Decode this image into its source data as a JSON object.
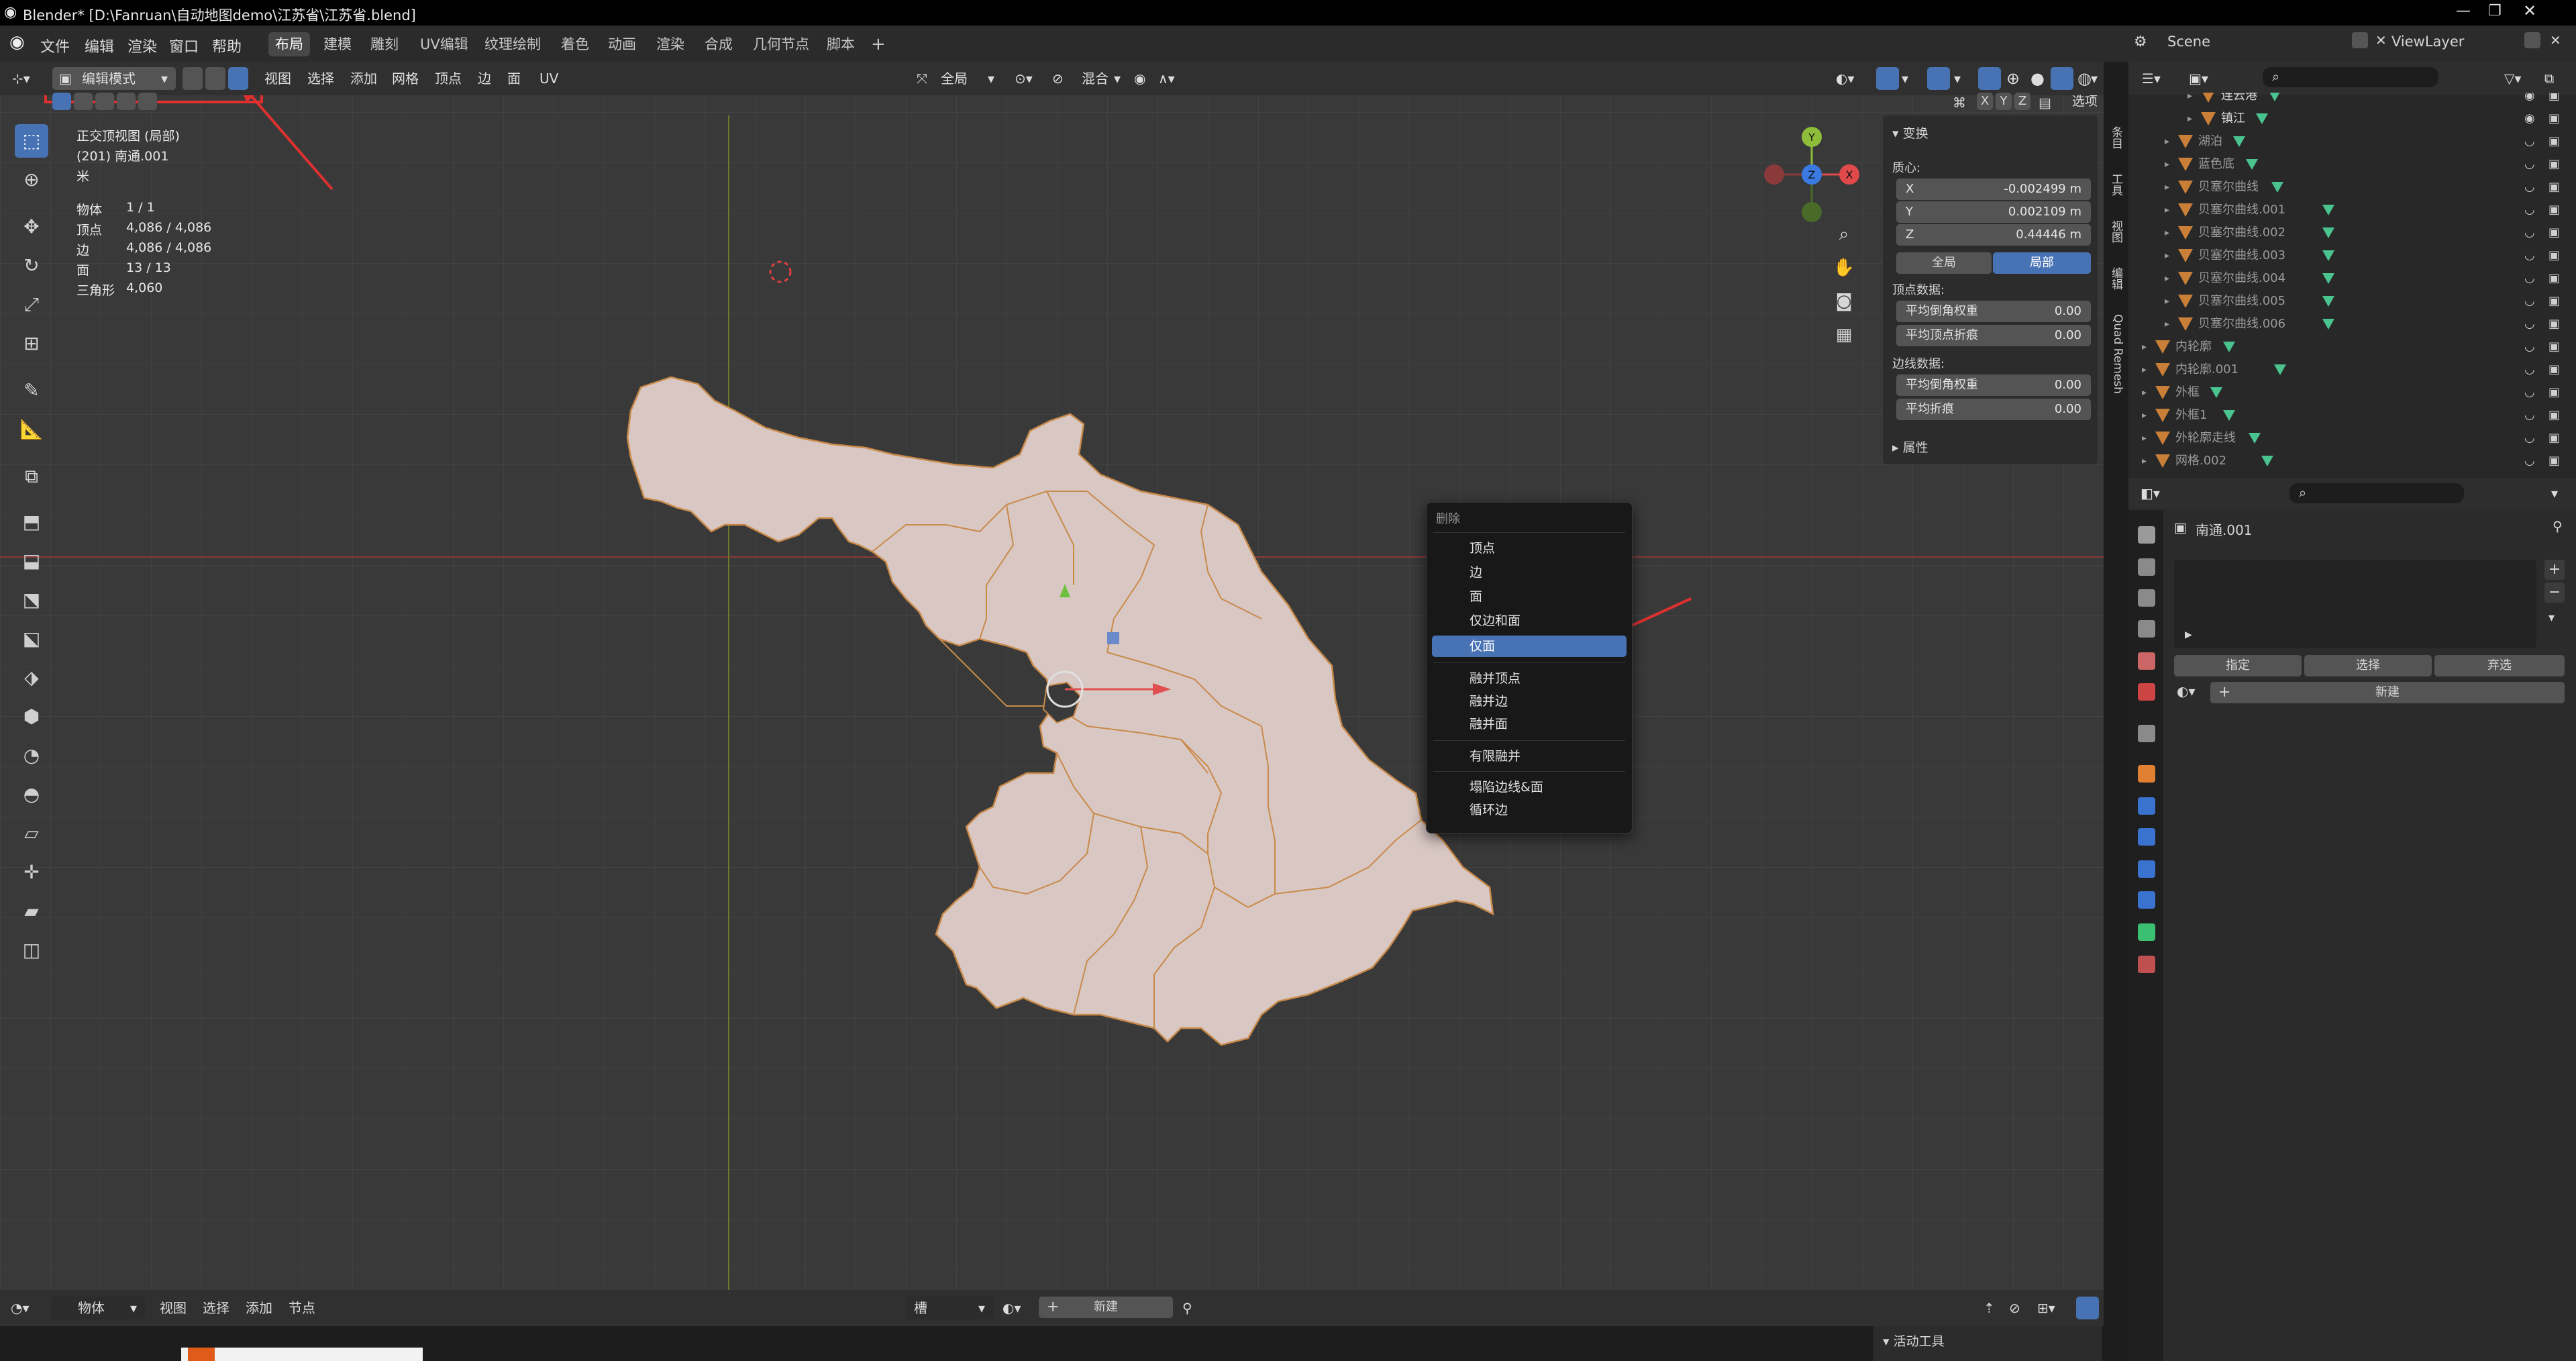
{
  "app": {
    "title": "Blender* [D:\\Fanruan\\自动地图demo\\江苏省\\江苏省.blend]"
  },
  "menu": [
    "文件",
    "编辑",
    "渲染",
    "窗口",
    "帮助"
  ],
  "workspaces": [
    "布局",
    "建模",
    "雕刻",
    "UV编辑",
    "纹理绘制",
    "着色",
    "动画",
    "渲染",
    "合成",
    "几何节点",
    "脚本"
  ],
  "active_workspace": "布局",
  "scene": "Scene",
  "view_layer": "ViewLayer",
  "header3d": {
    "mode": "编辑模式",
    "menus": [
      "视图",
      "选择",
      "添加",
      "网格",
      "顶点",
      "边",
      "面",
      "UV"
    ],
    "transform_orientation": "全局",
    "snap": "混合",
    "options": "选项",
    "axes": [
      "X",
      "Y",
      "Z"
    ]
  },
  "overlay_info": {
    "view": "正交顶视图 (局部)",
    "object": "(201) 南通.001",
    "unit": "米",
    "stats": [
      {
        "label": "物体",
        "value": "1 / 1"
      },
      {
        "label": "顶点",
        "value": "4,086 / 4,086"
      },
      {
        "label": "边",
        "value": "4,086 / 4,086"
      },
      {
        "label": "面",
        "value": "13 / 13"
      },
      {
        "label": "三角形",
        "value": "4,060"
      }
    ]
  },
  "npanel": {
    "transform_title": "变换",
    "median_label": "质心:",
    "x": {
      "label": "X",
      "value": "-0.002499 m"
    },
    "y": {
      "label": "Y",
      "value": "0.002109 m"
    },
    "z": {
      "label": "Z",
      "value": "0.44446 m"
    },
    "global": "全局",
    "local": "局部",
    "vertex_data": "顶点数据:",
    "mean_bevel_weight": "平均倒角权重",
    "mean_bevel_weight_val": "0.00",
    "mean_vertex_crease": "平均顶点折痕",
    "mean_vertex_crease_val": "0.00",
    "edge_data": "边线数据:",
    "edge_bevel_weight": "平均倒角权重",
    "edge_bevel_weight_val": "0.00",
    "edge_crease": "平均折痕",
    "edge_crease_val": "0.00",
    "properties_title": "属性",
    "vtabs": [
      "条目",
      "工具",
      "视图",
      "编辑",
      "Quad Remesh"
    ]
  },
  "context_menu": {
    "title": "删除",
    "items": [
      "顶点",
      "边",
      "面",
      "仅边和面",
      "仅面",
      "融并顶点",
      "融并边",
      "融并面",
      "有限融并",
      "塌陷边线&面",
      "循环边"
    ],
    "selected": "仅面"
  },
  "outliner": {
    "rows": [
      "连云港",
      "镇江",
      "湖泊",
      "蓝色底",
      "贝塞尔曲线",
      "贝塞尔曲线.001",
      "贝塞尔曲线.002",
      "贝塞尔曲线.003",
      "贝塞尔曲线.004",
      "贝塞尔曲线.005",
      "贝塞尔曲线.006",
      "内轮廓",
      "内轮廓.001",
      "外框",
      "外框1",
      "外轮廓走线",
      "网格.002"
    ]
  },
  "properties": {
    "object_name": "南通.001",
    "assign": "指定",
    "select": "选择",
    "deselect": "弃选",
    "new": "新建"
  },
  "bottom": {
    "editor": "物体",
    "menus": [
      "视图",
      "选择",
      "添加",
      "节点"
    ],
    "slot": "槽",
    "new": "新建",
    "active_tool": "活动工具"
  },
  "colors": {
    "accent": "#4772b3",
    "map_fill": "#d9c6c2",
    "map_edge": "#c98a4a",
    "annotation": "#e03030"
  }
}
